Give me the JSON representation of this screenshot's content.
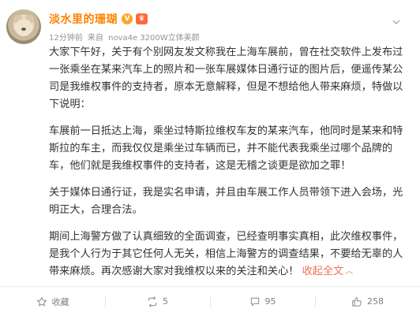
{
  "user": {
    "name": "淡水里的珊瑚",
    "vip_badge": "V",
    "level_badge": "♛"
  },
  "meta": {
    "time": "12分钟前",
    "source_prefix": "来自",
    "device": "nova4e 3200W立体美颜"
  },
  "post": {
    "paragraphs": [
      "大家下午好，关于有个别网友发文称我在上海车展前，曾在社交软件上发布过一张乘坐在某来汽车上的照片和一张车展媒体日通行证的图片后，便遥传某公司是我维权事件的支持者，原本无意解释，但是不想给他人带来麻烦，特做以下说明：",
      "车展前一日抵达上海，乘坐过特斯拉维权车友的某来汽车，他同时是某来和特斯拉的车主，而我仅仅是乘坐过车辆而已，并不能代表我乘坐过哪个品牌的车，他们就是我维权事件的支持者，这是无稽之谈更是欲加之罪！",
      "关于媒体日通行证，我是实名申请，并且由车展工作人员带领下进入会场，光明正大，合理合法。"
    ],
    "last_paragraph": "期间上海警方做了认真细致的全面调查，已经查明事实真相，此次维权事件，是我个人行为于其它任何人无关，相信上海警方的调查结果，不要给无辜的人带来麻烦。再次感谢大家对我维权以来的关注和关心！",
    "collapse_label": "收起全文",
    "collapse_icon": "chevron-up"
  },
  "actions": {
    "favorite_label": "收藏",
    "repost_count": "5",
    "comment_count": "95",
    "like_count": "258"
  },
  "colors": {
    "username": "#ff8200",
    "link": "#eb7350",
    "meta": "#939393"
  }
}
